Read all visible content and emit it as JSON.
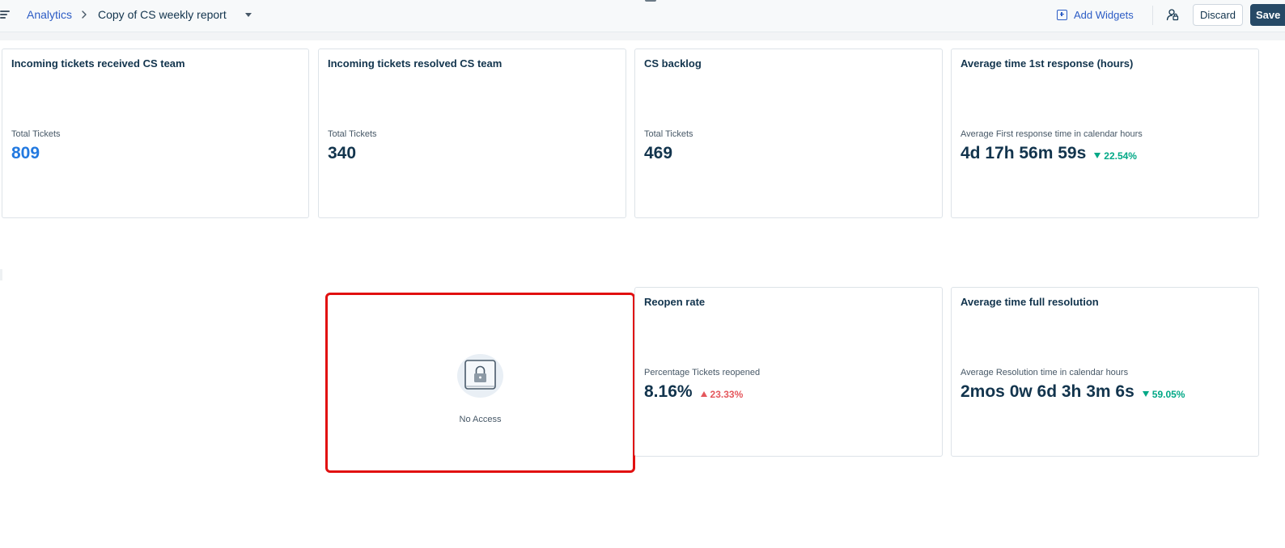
{
  "header": {
    "breadcrumb_root": "Analytics",
    "report_title": "Copy of CS weekly report",
    "add_widgets_label": "Add Widgets",
    "discard_label": "Discard",
    "save_label": "Save"
  },
  "widgets": [
    {
      "title": "Incoming tickets received CS team",
      "metric_label": "Total Tickets",
      "value": "809",
      "value_color": "#2279e0"
    },
    {
      "title": "Incoming tickets resolved CS team",
      "metric_label": "Total Tickets",
      "value": "340"
    },
    {
      "title": "CS backlog",
      "metric_label": "Total Tickets",
      "value": "469"
    },
    {
      "title": "Average time 1st response (hours)",
      "metric_label": "Average First response time in calendar hours",
      "value": "4d 17h 56m 59s",
      "trend": "22.54%",
      "trend_direction": "down"
    },
    {
      "title": "Reopen rate",
      "metric_label": "Percentage Tickets reopened",
      "value": "8.16%",
      "trend": "23.33%",
      "trend_direction": "up"
    },
    {
      "title": "Average time full resolution",
      "metric_label": "Average Resolution time in calendar hours",
      "value": "2mos 0w 6d 3h 3m 6s",
      "trend": "59.05%",
      "trend_direction": "down"
    }
  ],
  "no_access_widget": {
    "label": "No Access",
    "icon": "lock-icon"
  },
  "colors": {
    "primary_link": "#2c5cc5",
    "save_button": "#264966",
    "trend_down": "#00a886",
    "trend_up": "#e4575c",
    "highlight_border": "#e11010"
  }
}
